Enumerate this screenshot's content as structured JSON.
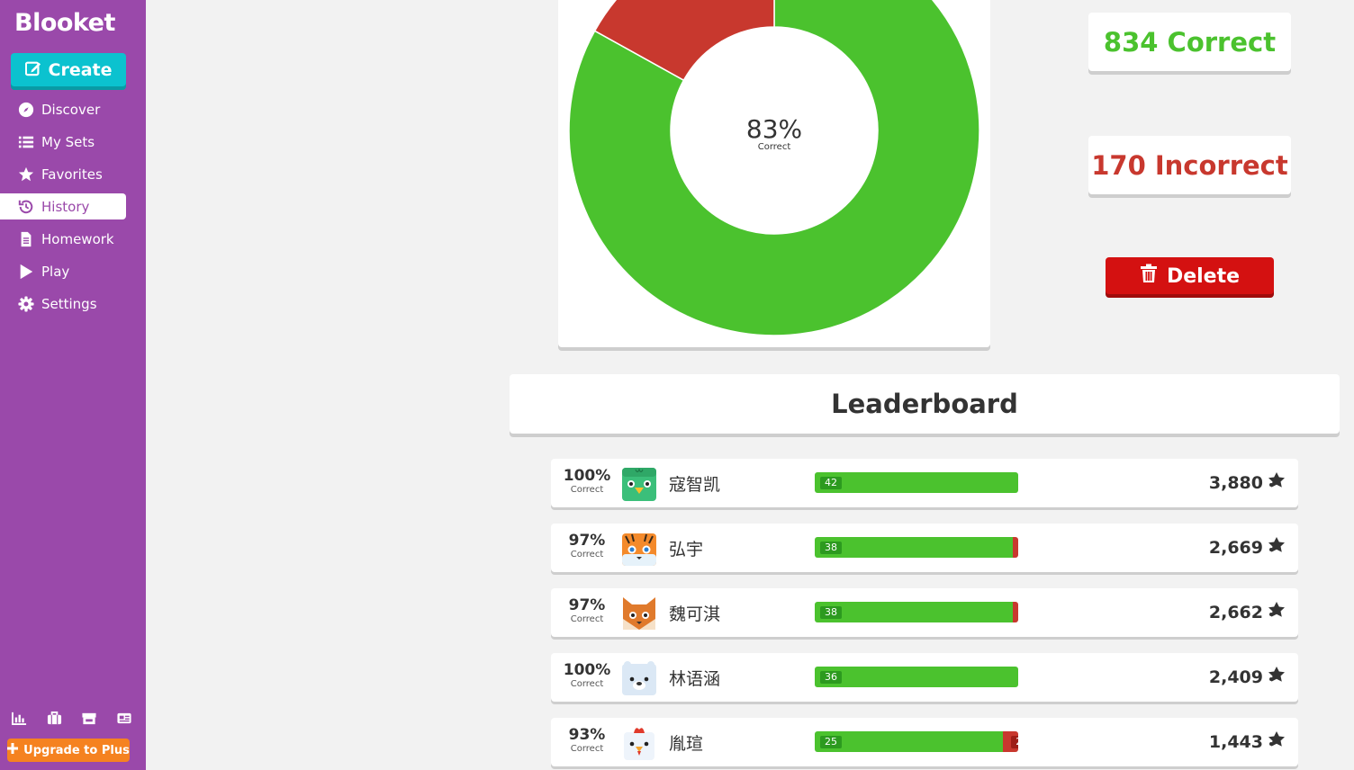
{
  "sidebar": {
    "logo": "Blooket",
    "create_label": "Create",
    "items": [
      {
        "label": "Discover",
        "icon": "compass-icon"
      },
      {
        "label": "My Sets",
        "icon": "list-icon"
      },
      {
        "label": "Favorites",
        "icon": "star-icon"
      },
      {
        "label": "History",
        "icon": "history-icon",
        "active": true
      },
      {
        "label": "Homework",
        "icon": "document-icon"
      },
      {
        "label": "Play",
        "icon": "play-icon"
      },
      {
        "label": "Settings",
        "icon": "gear-icon"
      }
    ],
    "bottom_icons": [
      "stats-icon",
      "briefcase-icon",
      "market-icon",
      "news-icon"
    ],
    "upgrade_label": "Upgrade to Plus"
  },
  "chart": {
    "center_value": "83%",
    "center_label": "Correct"
  },
  "chart_data": {
    "type": "pie",
    "slices": [
      {
        "label": "Correct",
        "value": 834,
        "color": "#4bc22e"
      },
      {
        "label": "Incorrect",
        "value": 170,
        "color": "#c8382e"
      }
    ]
  },
  "stats": {
    "correct_text": "834 Correct",
    "incorrect_text": "170 Incorrect",
    "delete_label": "Delete"
  },
  "leaderboard": {
    "title": "Leaderboard",
    "rows": [
      {
        "pct": "100%",
        "pct_label": "Correct",
        "name": "寇智凯",
        "correct": 42,
        "incorrect": 0,
        "score": "3,880",
        "avatar": "green-bird"
      },
      {
        "pct": "97%",
        "pct_label": "Correct",
        "name": "弘宇",
        "correct": 38,
        "incorrect": 1,
        "score": "2,669",
        "avatar": "tiger"
      },
      {
        "pct": "97%",
        "pct_label": "Correct",
        "name": "魏可淇",
        "correct": 38,
        "incorrect": 1,
        "score": "2,662",
        "avatar": "fox"
      },
      {
        "pct": "100%",
        "pct_label": "Correct",
        "name": "林语涵",
        "correct": 36,
        "incorrect": 0,
        "score": "2,409",
        "avatar": "polar-bear"
      },
      {
        "pct": "93%",
        "pct_label": "Correct",
        "name": "胤瑄",
        "correct": 25,
        "incorrect": 2,
        "score": "1,443",
        "avatar": "chicken"
      }
    ]
  },
  "colors": {
    "sidebar": "#9a49aa",
    "create": "#0bc2cf",
    "correct": "#4bc22e",
    "incorrect": "#c8382e",
    "delete": "#d41111",
    "upgrade": "#f58220"
  }
}
